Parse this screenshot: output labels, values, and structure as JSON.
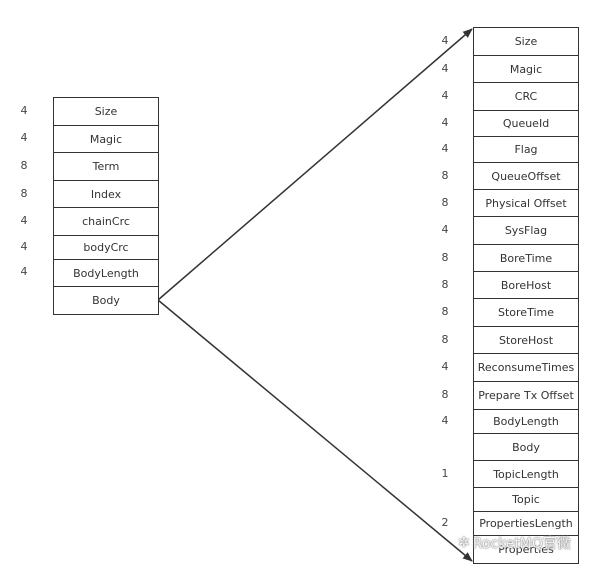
{
  "left_table": {
    "rows": [
      {
        "size": "4",
        "label": "Size"
      },
      {
        "size": "4",
        "label": "Magic"
      },
      {
        "size": "8",
        "label": "Term"
      },
      {
        "size": "8",
        "label": "Index"
      },
      {
        "size": "4",
        "label": "chainCrc"
      },
      {
        "size": "4",
        "label": "bodyCrc"
      },
      {
        "size": "4",
        "label": "BodyLength"
      },
      {
        "size": "",
        "label": "Body"
      }
    ]
  },
  "right_table": {
    "rows": [
      {
        "size": "4",
        "label": "Size"
      },
      {
        "size": "4",
        "label": "Magic"
      },
      {
        "size": "4",
        "label": "CRC"
      },
      {
        "size": "4",
        "label": "QueueId"
      },
      {
        "size": "4",
        "label": "Flag"
      },
      {
        "size": "8",
        "label": "QueueOffset"
      },
      {
        "size": "8",
        "label": "Physical Offset"
      },
      {
        "size": "4",
        "label": "SysFlag"
      },
      {
        "size": "8",
        "label": "BoreTime"
      },
      {
        "size": "8",
        "label": "BoreHost"
      },
      {
        "size": "8",
        "label": "StoreTime"
      },
      {
        "size": "8",
        "label": "StoreHost"
      },
      {
        "size": "4",
        "label": "ReconsumeTimes"
      },
      {
        "size": "8",
        "label": "Prepare Tx Offset"
      },
      {
        "size": "4",
        "label": "BodyLength"
      },
      {
        "size": "",
        "label": "Body"
      },
      {
        "size": "1",
        "label": "TopicLength"
      },
      {
        "size": "",
        "label": "Topic"
      },
      {
        "size": "2",
        "label": "PropertiesLength"
      },
      {
        "size": "",
        "label": "Properties"
      }
    ]
  },
  "watermark": {
    "text": "RocketMQ官微",
    "icon": "wechat-icon"
  },
  "colors": {
    "line": "#333333"
  }
}
